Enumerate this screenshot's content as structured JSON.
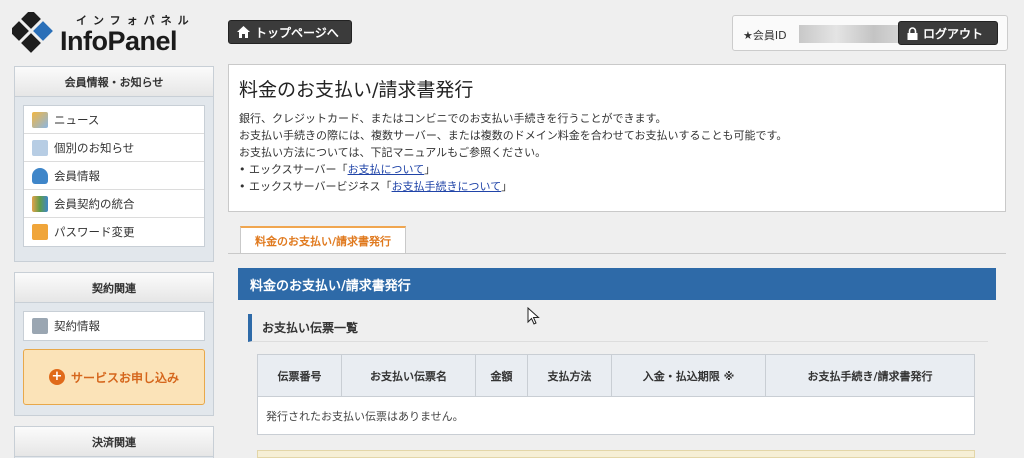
{
  "header": {
    "logo_kana": "インフォパネル",
    "logo_name": "InfoPanel",
    "top_page_button": "トップページへ",
    "member_id_label": "★会員ID",
    "logout_button": "ログアウト"
  },
  "sidebar": {
    "member_section": {
      "title": "会員情報・お知らせ",
      "items": [
        {
          "label": "ニュース",
          "icon": "key-icon"
        },
        {
          "label": "個別のお知らせ",
          "icon": "message-icon"
        },
        {
          "label": "会員情報",
          "icon": "user-icon"
        },
        {
          "label": "会員契約の統合",
          "icon": "users-icon"
        },
        {
          "label": "パスワード変更",
          "icon": "lock-icon"
        }
      ]
    },
    "contract_section": {
      "title": "契約関連",
      "items": [
        {
          "label": "契約情報",
          "icon": "document-icon"
        }
      ],
      "service_button": "サービスお申し込み"
    },
    "payment_section": {
      "title": "決済関連"
    }
  },
  "intro": {
    "title": "料金のお支払い/請求書発行",
    "lines": [
      "銀行、クレジットカード、またはコンビニでのお支払い手続きを行うことができます。",
      "お支払い手続きの際には、複数サーバー、または複数のドメイン料金を合わせてお支払いすることも可能です。",
      "お支払い方法については、下記マニュアルもご参照ください。"
    ],
    "links": [
      {
        "prefix": "エックスサーバー「",
        "text": "お支払について",
        "suffix": "」"
      },
      {
        "prefix": "エックスサーバービジネス「",
        "text": "お支払手続きについて",
        "suffix": "」"
      }
    ]
  },
  "tab": {
    "label": "料金のお支払い/請求書発行"
  },
  "section_title": "料金のお支払い/請求書発行",
  "subsection_title": "お支払い伝票一覧",
  "table": {
    "columns": [
      "伝票番号",
      "お支払い伝票名",
      "金額",
      "支払方法",
      "入金・払込期限 ※",
      "お支払手続き/請求書発行"
    ],
    "empty_message": "発行されたお支払い伝票はありません。"
  },
  "colors": {
    "accent_blue": "#2e6aa8",
    "accent_orange": "#e07a1f",
    "dark_button": "#3b3b3b"
  }
}
